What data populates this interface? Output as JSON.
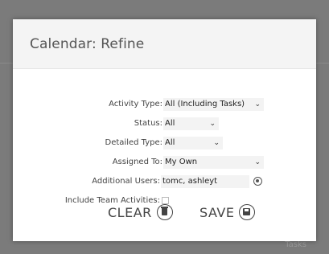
{
  "modal": {
    "title": "Calendar: Refine"
  },
  "form": {
    "activity_type": {
      "label": "Activity Type:",
      "value": "All (Including Tasks)"
    },
    "status": {
      "label": "Status:",
      "value": "All"
    },
    "detailed_type": {
      "label": "Detailed Type:",
      "value": "All"
    },
    "assigned_to": {
      "label": "Assigned To:",
      "value": "My Own"
    },
    "additional_users": {
      "label": "Additional Users:",
      "value": "tomc, ashleyt"
    },
    "include_team": {
      "label": "Include Team Activities:",
      "checked": false
    }
  },
  "actions": {
    "clear_label": "CLEAR",
    "save_label": "SAVE"
  },
  "background": {
    "tab_label": "Tasks"
  },
  "icons": {
    "chevron": "chevron-down-icon",
    "lookup": "lookup-icon",
    "clear": "trash-icon",
    "save": "save-disk-icon"
  }
}
